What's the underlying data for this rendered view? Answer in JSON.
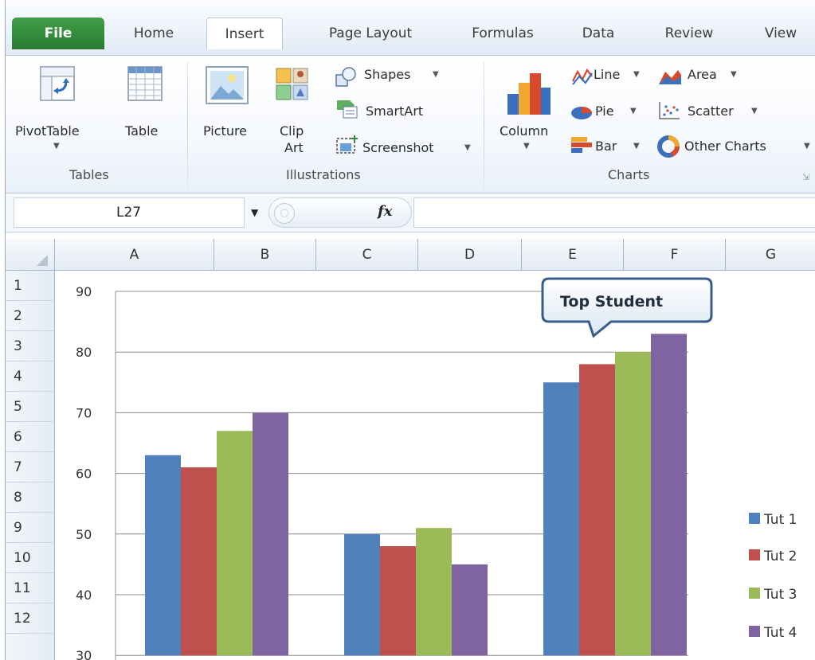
{
  "tabs": {
    "file": "File",
    "home": "Home",
    "insert": "Insert",
    "page_layout": "Page Layout",
    "formulas": "Formulas",
    "data": "Data",
    "review": "Review",
    "view": "View"
  },
  "ribbon": {
    "tables": {
      "group_label": "Tables",
      "pivottable": "PivotTable",
      "table": "Table"
    },
    "illustrations": {
      "group_label": "Illustrations",
      "picture": "Picture",
      "clip_art_line1": "Clip",
      "clip_art_line2": "Art",
      "shapes": "Shapes",
      "smartart": "SmartArt",
      "screenshot": "Screenshot"
    },
    "charts": {
      "group_label": "Charts",
      "column": "Column",
      "line": "Line",
      "area": "Area",
      "pie": "Pie",
      "scatter": "Scatter",
      "bar": "Bar",
      "other_charts": "Other Charts"
    }
  },
  "formula_bar": {
    "name_box": "L27",
    "fx": "fx",
    "formula": ""
  },
  "columns": [
    "A",
    "B",
    "C",
    "D",
    "E",
    "F",
    "G"
  ],
  "rows": [
    "1",
    "2",
    "3",
    "4",
    "5",
    "6",
    "7",
    "8",
    "9",
    "10",
    "11",
    "12"
  ],
  "colors": {
    "tut1": "#4f81bd",
    "tut2": "#c0504d",
    "tut3": "#9bbb59",
    "tut4": "#8064a2",
    "file_tab": "#2f8c3a",
    "callout_border": "#385d8a"
  },
  "chart_data": {
    "type": "bar",
    "y_ticks": [
      "90",
      "80",
      "70",
      "60",
      "50",
      "40",
      "30"
    ],
    "ylim": [
      30,
      90
    ],
    "grid": true,
    "legend_position": "right",
    "groups": 3,
    "series": [
      {
        "name": "Tut 1",
        "values": [
          63,
          50,
          75
        ]
      },
      {
        "name": "Tut 2",
        "values": [
          61,
          48,
          78
        ]
      },
      {
        "name": "Tut 3",
        "values": [
          67,
          51,
          80
        ]
      },
      {
        "name": "Tut 4",
        "values": [
          70,
          45,
          83
        ]
      }
    ],
    "annotation": "Top Student"
  }
}
